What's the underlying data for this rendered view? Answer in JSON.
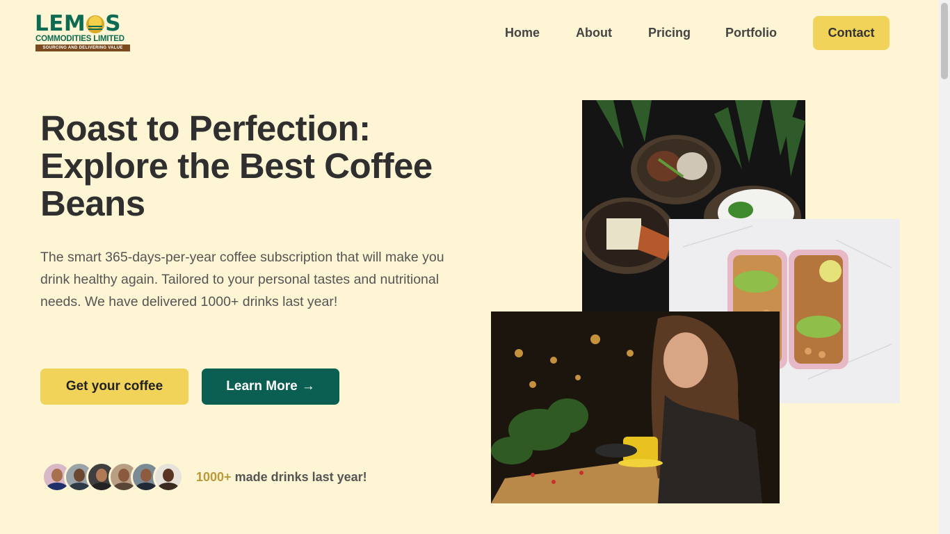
{
  "brand": {
    "name_part1": "LEM",
    "name_part2": "S",
    "subtitle": "COMMODITIES LIMITED",
    "tagline": "SOURCING AND DELIVERING VALUE"
  },
  "nav": {
    "home": "Home",
    "about": "About",
    "pricing": "Pricing",
    "portfolio": "Portfolio",
    "contact": "Contact"
  },
  "hero": {
    "title": "Roast to Perfection: Explore the Best Coffee Beans",
    "description": "The smart 365-days-per-year coffee subscription that will make you drink healthy again. Tailored to your personal tastes and nutritional needs. We have delivered 1000+ drinks last year!",
    "primary_button": "Get your coffee",
    "secondary_button": "Learn More",
    "secondary_button_arrow": "→"
  },
  "social_proof": {
    "count": "1000+",
    "text": " made drinks last year!"
  },
  "colors": {
    "background": "#fdf5d3",
    "accent_yellow": "#f1d35a",
    "accent_green": "#0b5f52",
    "brand_green": "#0c6b52",
    "highlight_gold": "#b9993a"
  }
}
